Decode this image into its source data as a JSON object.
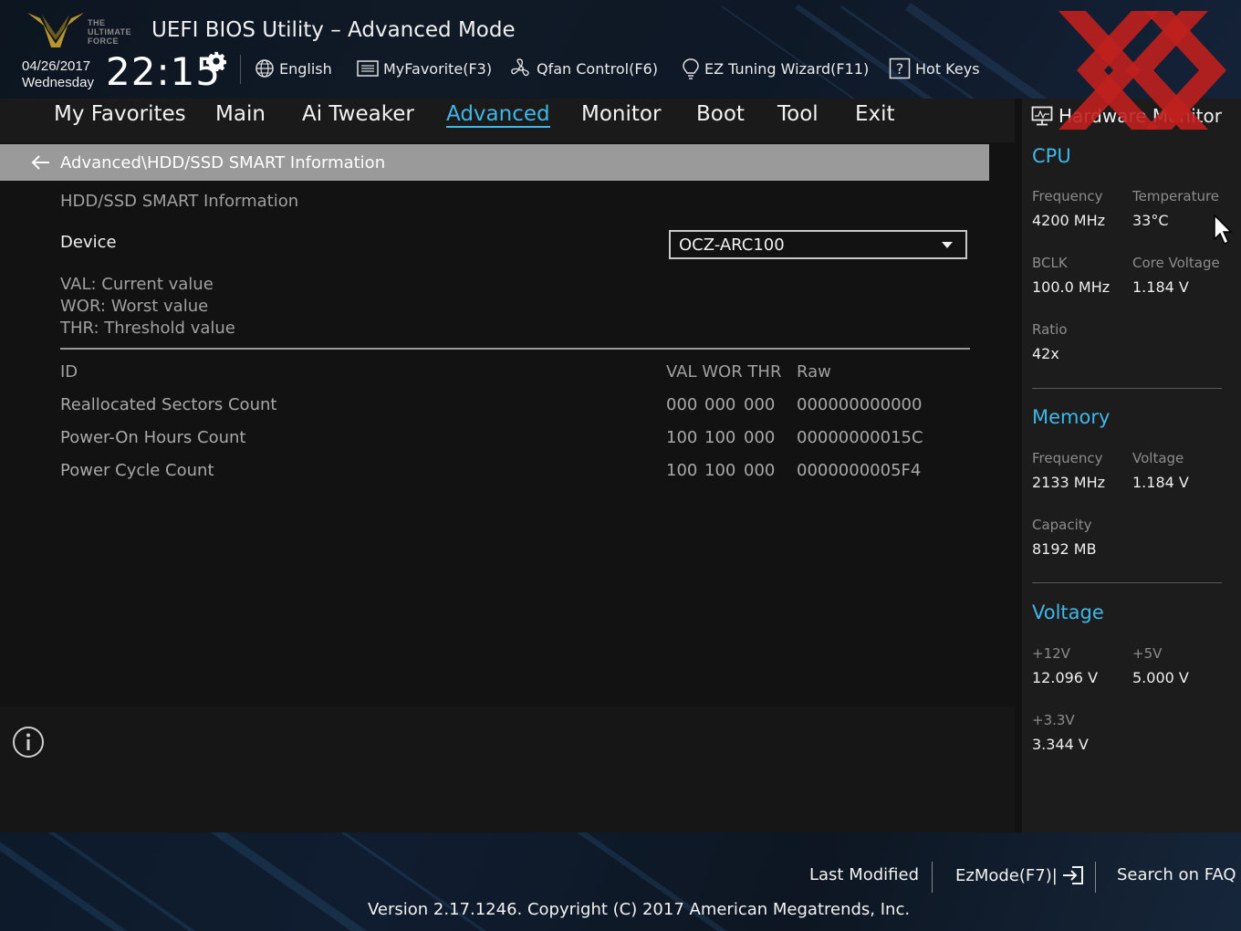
{
  "header": {
    "logo_text": [
      "THE",
      "ULTIMATE",
      "FORCE"
    ],
    "title": "UEFI BIOS Utility – Advanced Mode",
    "date": "04/26/2017",
    "weekday": "Wednesday",
    "time": "22:15",
    "toolbar": {
      "language": "English",
      "favorite": "MyFavorite(F3)",
      "qfan": "Qfan Control(F6)",
      "ez_tuning": "EZ Tuning Wizard(F11)",
      "hot_keys": "Hot Keys"
    }
  },
  "nav": {
    "tabs": [
      "My Favorites",
      "Main",
      "Ai Tweaker",
      "Advanced",
      "Monitor",
      "Boot",
      "Tool",
      "Exit"
    ],
    "active": "Advanced"
  },
  "main": {
    "breadcrumb": "Advanced\\HDD/SSD SMART Information",
    "section_title": "HDD/SSD SMART Information",
    "device_label": "Device",
    "device_value": "OCZ-ARC100",
    "legend": [
      "VAL:  Current value",
      "WOR: Worst value",
      "THR:  Threshold value"
    ],
    "columns": {
      "id": "ID",
      "val_wor_thr": "VAL WOR THR",
      "raw": "Raw"
    },
    "rows": [
      {
        "name": "Reallocated Sectors Count",
        "val": "000",
        "wor": "000",
        "thr": "000",
        "raw": "000000000000"
      },
      {
        "name": "Power-On Hours Count",
        "val": "100",
        "wor": "100",
        "thr": "000",
        "raw": "00000000015C"
      },
      {
        "name": "Power Cycle Count",
        "val": "100",
        "wor": "100",
        "thr": "000",
        "raw": "0000000005F4"
      }
    ]
  },
  "hardware_monitor": {
    "title": "Hardware Monitor",
    "cpu": {
      "heading": "CPU",
      "frequency_label": "Frequency",
      "frequency": "4200 MHz",
      "temperature_label": "Temperature",
      "temperature": "33°C",
      "bclk_label": "BCLK",
      "bclk": "100.0 MHz",
      "core_voltage_label": "Core Voltage",
      "core_voltage": "1.184 V",
      "ratio_label": "Ratio",
      "ratio": "42x"
    },
    "memory": {
      "heading": "Memory",
      "frequency_label": "Frequency",
      "frequency": "2133 MHz",
      "voltage_label": "Voltage",
      "voltage": "1.184 V",
      "capacity_label": "Capacity",
      "capacity": "8192 MB"
    },
    "voltage": {
      "heading": "Voltage",
      "v12_label": "+12V",
      "v12": "12.096 V",
      "v5_label": "+5V",
      "v5": "5.000 V",
      "v33_label": "+3.3V",
      "v33": "3.344 V"
    }
  },
  "footer": {
    "last_modified": "Last Modified",
    "ezmode": "EzMode(F7)|",
    "search_faq": "Search on FAQ",
    "version": "Version 2.17.1246. Copyright (C) 2017 American Megatrends, Inc."
  },
  "colors": {
    "accent": "#3fb7e8",
    "watermark": "#c0201e",
    "breadcrumb_bar": "#9a9a9a"
  }
}
